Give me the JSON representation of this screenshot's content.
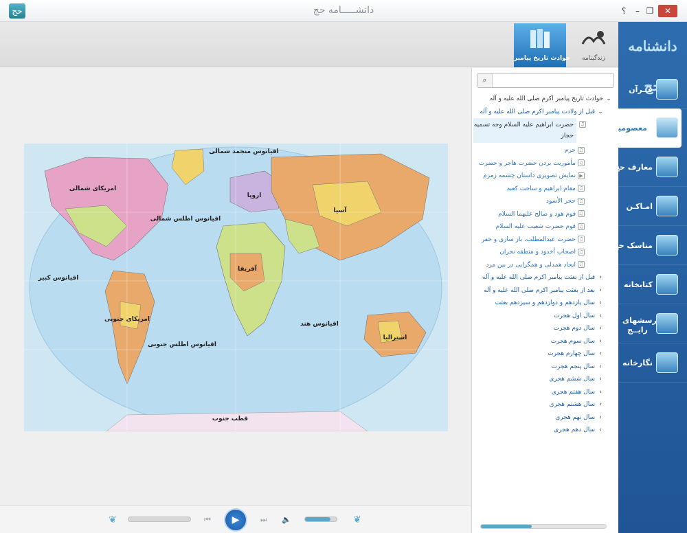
{
  "window": {
    "title": "دانشـــــامه حج",
    "app_icon_glyph": "حج",
    "help_label": "؟",
    "minimize_label": "–",
    "restore_label": "❐",
    "close_label": "✕"
  },
  "sidebar": {
    "logo_text": "دانشنامه حج",
    "items": [
      {
        "label": "قــرآن",
        "icon": "quran-icon",
        "active": false
      },
      {
        "label": "معصومین",
        "icon": "mosque-icon",
        "active": true
      },
      {
        "label": "معارف حج",
        "icon": "kaaba-book-icon",
        "active": false
      },
      {
        "label": "امـاکـن",
        "icon": "minaret-icon",
        "active": false
      },
      {
        "label": "مناسک حج",
        "icon": "pilgrim-icon",
        "active": false
      },
      {
        "label": "کتابخانه",
        "icon": "library-icon",
        "active": false
      },
      {
        "label": "پرسشهای رایــج",
        "icon": "faq-icon",
        "active": false
      },
      {
        "label": "نگارخانه",
        "icon": "gallery-icon",
        "active": false
      }
    ]
  },
  "tabs": [
    {
      "label": "زندگینامه",
      "icon": "biography-icon",
      "active": false
    },
    {
      "label": "حوادث تاریخ پیامبر",
      "icon": "history-book-icon",
      "active": true
    }
  ],
  "player": {
    "progress_fraction": 0,
    "volume_fraction": 0.8,
    "prev_label": "⏮",
    "play_label": "▶",
    "next_label": "⏭",
    "volume_label": "🔈",
    "ornament_glyph": "❦"
  },
  "search": {
    "button_glyph": "⌕",
    "value": "",
    "placeholder": ""
  },
  "tree": [
    {
      "text": "حوادث تاریخ پیامبر اکرم صلی الله علیه و آله",
      "level": 0,
      "chevron": "⌄"
    },
    {
      "text": "قبل از ولادت پیامبر اکرم صلی الله علیه و آله",
      "level": 1,
      "chevron": "⌄"
    },
    {
      "text": "حضرت ابراهیم علیه السلام وجه تسمیه حجاز",
      "level": 2,
      "icon": "♫",
      "selected": true
    },
    {
      "text": "حرم",
      "level": 2,
      "icon": "♫"
    },
    {
      "text": "مأموریت بردن حضرت هاجر و حضرت",
      "level": 2,
      "icon": "♫"
    },
    {
      "text": "نمایش تصویری داستان چشمه زمزم",
      "level": 2,
      "icon": "▶"
    },
    {
      "text": "مقام ابراهیم و ساخت کعبه",
      "level": 2,
      "icon": "♫"
    },
    {
      "text": "حجر الأسود",
      "level": 2,
      "icon": "♫"
    },
    {
      "text": "قوم هود و صالح علیهما السلام",
      "level": 2,
      "icon": "♫"
    },
    {
      "text": "قوم حضرت شعیب علیه السلام",
      "level": 2,
      "icon": "♫"
    },
    {
      "text": "حضرت عبدالمطلب، باز سازی و حفر",
      "level": 2,
      "icon": "♫"
    },
    {
      "text": "اصحاب أخدود و منطقه نجران",
      "level": 2,
      "icon": "♫"
    },
    {
      "text": "ایجاد همدلی و همگرایی در بین مرد",
      "level": 2,
      "icon": "♫"
    },
    {
      "text": "قبل از بعثت پیامبر اکرم صلی الله علیه و آله",
      "level": 1,
      "chevron": "›"
    },
    {
      "text": "بعد از بعثت پیامبر اکرم صلی الله علیه و آله",
      "level": 1,
      "chevron": "›"
    },
    {
      "text": "سال یازدهم و دوازدهم و سیزدهم بعثت",
      "level": 1,
      "chevron": "›"
    },
    {
      "text": "سال اول هجرت",
      "level": 1,
      "chevron": "›"
    },
    {
      "text": "سال دوم هجرت",
      "level": 1,
      "chevron": "›"
    },
    {
      "text": "سال سوم هجرت",
      "level": 1,
      "chevron": "›"
    },
    {
      "text": "سال چهارم هجرت",
      "level": 1,
      "chevron": "›"
    },
    {
      "text": "سال پنجم هجرت",
      "level": 1,
      "chevron": "›"
    },
    {
      "text": "سال ششم هجری",
      "level": 1,
      "chevron": "›"
    },
    {
      "text": "سال هفتم هجری",
      "level": 1,
      "chevron": "›"
    },
    {
      "text": "سال هشتم هجری",
      "level": 1,
      "chevron": "›"
    },
    {
      "text": "سال نهم هجری",
      "level": 1,
      "chevron": "›"
    },
    {
      "text": "سال دهم هجری",
      "level": 1,
      "chevron": "›"
    }
  ],
  "map": {
    "labels": [
      "اقیانوس منجمد شمالی",
      "امریکای شمالی",
      "اقیانوس اطلس شمالی",
      "آسیا",
      "اروپا",
      "آفریقا",
      "اقیانوس کبیر",
      "امریکای جنوبی",
      "اقیانوس اطلس جنوبی",
      "اقیانوس هند",
      "استرالیا",
      "قطب جنوب"
    ],
    "colors": {
      "ocean": "#cfe6f3",
      "land_a": "#e9a96b",
      "land_b": "#f0d36a",
      "land_c": "#cde08a",
      "land_d": "#e7a3c6",
      "land_e": "#c9b4e0"
    }
  },
  "tree_scroll": {
    "position_fraction": 0
  }
}
